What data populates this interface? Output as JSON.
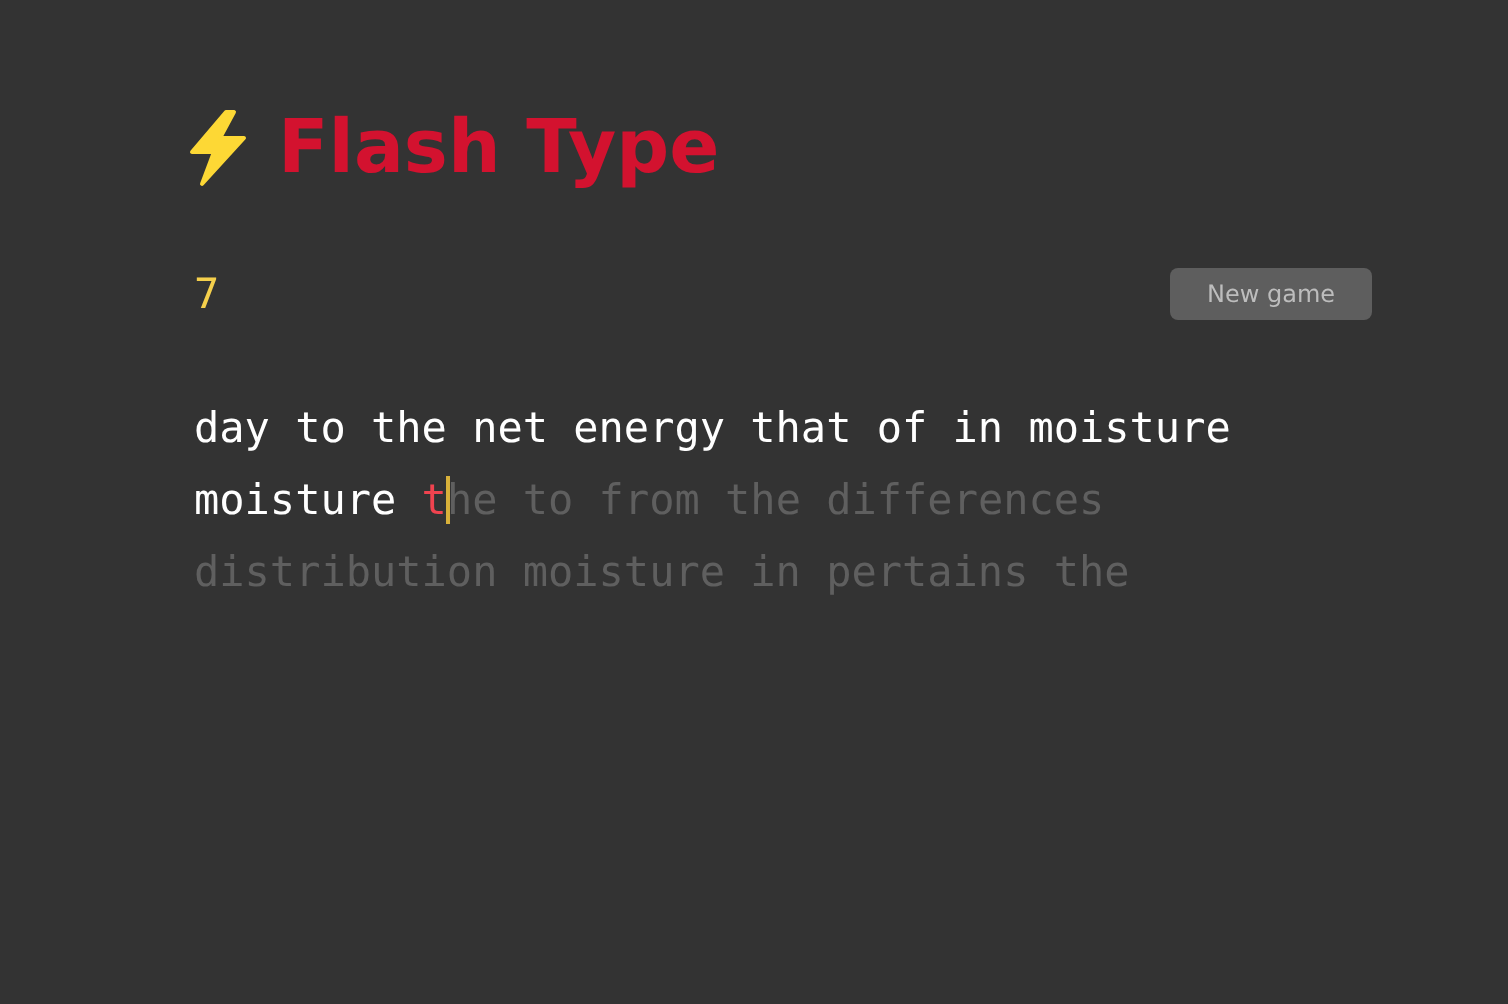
{
  "header": {
    "title": "Flash Type"
  },
  "toolbar": {
    "score": "7",
    "new_game_button": "New game"
  },
  "passage": {
    "segments": [
      {
        "kind": "correct",
        "text": "day to the net energy that of in moisture moisture ",
        "cursor_after": false
      },
      {
        "kind": "wrong",
        "text": "t",
        "cursor_after": true
      },
      {
        "kind": "pending",
        "text": "he to from the differences distribution moisture in pertains the",
        "cursor_after": false
      }
    ]
  }
}
